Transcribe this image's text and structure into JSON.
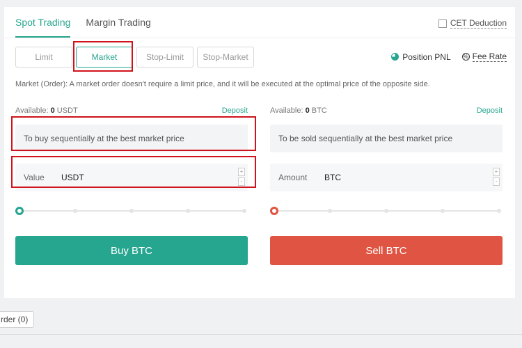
{
  "tabs": [
    {
      "label": "Spot Trading",
      "active": true
    },
    {
      "label": "Margin Trading",
      "active": false
    }
  ],
  "cet": {
    "label": "CET Deduction",
    "checked": false
  },
  "order_types": [
    {
      "label": "Limit",
      "active": false
    },
    {
      "label": "Market",
      "active": true
    },
    {
      "label": "Stop-Limit",
      "active": false
    },
    {
      "label": "Stop-Market",
      "active": false
    }
  ],
  "links": {
    "position_pnl": "Position PNL",
    "fee_rate": "Fee Rate",
    "fee_icon_glyph": "%"
  },
  "description": "Market (Order): A market order doesn't require a limit price, and it will be executed at the optimal price of the opposite side.",
  "buy": {
    "available_label": "Available:",
    "available_value": "0",
    "available_unit": "USDT",
    "deposit": "Deposit",
    "info": "To buy sequentially at the best market price",
    "input_label": "Value",
    "input_unit": "USDT",
    "button": "Buy BTC",
    "slider_value": 0
  },
  "sell": {
    "available_label": "Available:",
    "available_value": "0",
    "available_unit": "BTC",
    "deposit": "Deposit",
    "info": "To be sold sequentially at the best market price",
    "input_label": "Amount",
    "input_unit": "BTC",
    "button": "Sell BTC",
    "slider_value": 0
  },
  "stepper": {
    "plus": "+",
    "minus": "-"
  },
  "bottom": {
    "order_tab": "rder (0)"
  },
  "colors": {
    "accent": "#26a58f",
    "sell": "#e05443",
    "highlight": "#d0121a"
  }
}
